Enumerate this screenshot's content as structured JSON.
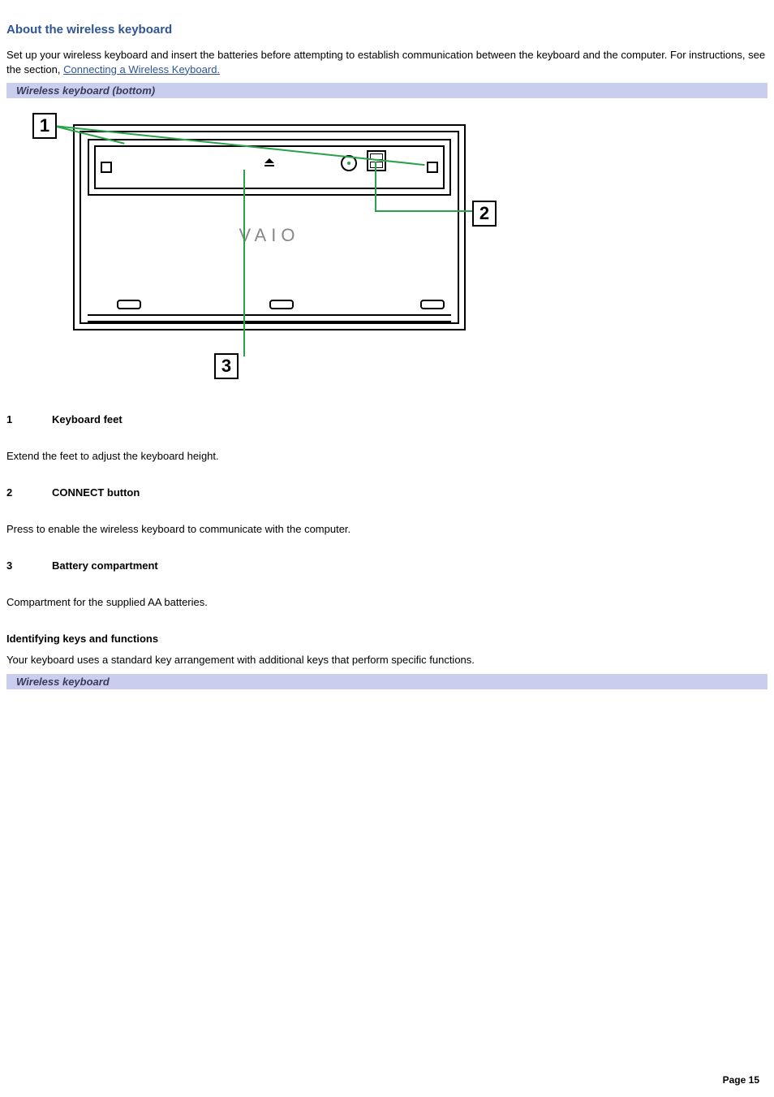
{
  "heading": "About the wireless keyboard",
  "intro": {
    "text_before_link": "Set up your wireless keyboard and insert the batteries before attempting to establish communication between the keyboard and the computer. For instructions, see the section, ",
    "link_text": "Connecting a Wireless Keyboard."
  },
  "figure1": {
    "caption": "Wireless keyboard (bottom)",
    "logo_text": "VAIO",
    "callouts": {
      "c1": "1",
      "c2": "2",
      "c3": "3"
    }
  },
  "items": [
    {
      "num": "1",
      "title": "Keyboard feet",
      "desc": "Extend the feet to adjust the keyboard height."
    },
    {
      "num": "2",
      "title": "CONNECT button",
      "desc": "Press to enable the wireless keyboard to communicate with the computer."
    },
    {
      "num": "3",
      "title": "Battery compartment",
      "desc": "Compartment for the supplied AA batteries."
    }
  ],
  "section2": {
    "heading": "Identifying keys and functions",
    "text": "Your keyboard uses a standard key arrangement with additional keys that perform specific functions."
  },
  "figure2": {
    "caption": "Wireless keyboard"
  },
  "footer": "Page 15"
}
